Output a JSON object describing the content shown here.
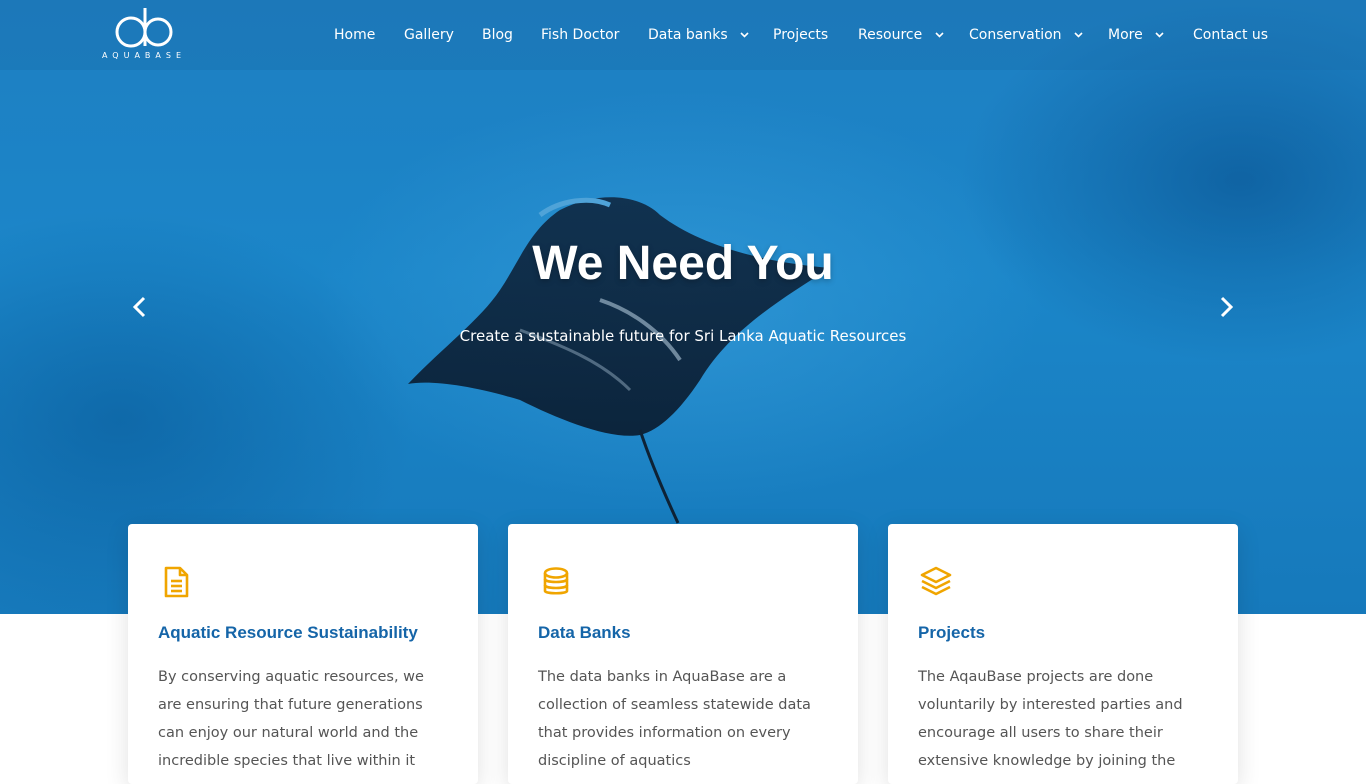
{
  "brand": {
    "logo_mark": "ab",
    "logo_text": "AQUABASE"
  },
  "nav": {
    "items": [
      {
        "label": "Home",
        "dropdown": false
      },
      {
        "label": "Gallery",
        "dropdown": false
      },
      {
        "label": "Blog",
        "dropdown": false
      },
      {
        "label": "Fish Doctor",
        "dropdown": false
      },
      {
        "label": "Data banks",
        "dropdown": true
      },
      {
        "label": "Projects",
        "dropdown": false
      },
      {
        "label": "Resource",
        "dropdown": true
      },
      {
        "label": "Conservation",
        "dropdown": true
      },
      {
        "label": "More",
        "dropdown": true
      },
      {
        "label": "Contact us",
        "dropdown": false
      }
    ]
  },
  "hero": {
    "title": "We Need You",
    "subtitle": "Create a sustainable future for Sri Lanka Aquatic Resources",
    "prev_icon": "chevron-left-icon",
    "next_icon": "chevron-right-icon"
  },
  "cards": [
    {
      "icon": "document-icon",
      "title": "Aquatic Resource Sustainability",
      "body": "By conserving aquatic resources, we are ensuring that future generations can enjoy our natural world and the incredible species that live within it"
    },
    {
      "icon": "database-icon",
      "title": "Data Banks",
      "body": "The data banks in AquaBase are a collection of seamless statewide data that provides information on every discipline of aquatics"
    },
    {
      "icon": "layers-icon",
      "title": "Projects",
      "body": "The AqauBase projects are done voluntarily by interested parties and encourage all users to share their extensive knowledge by joining the"
    }
  ],
  "colors": {
    "accent": "#f0a500",
    "title_blue": "#1565a8",
    "ocean": "#1b86c9"
  }
}
